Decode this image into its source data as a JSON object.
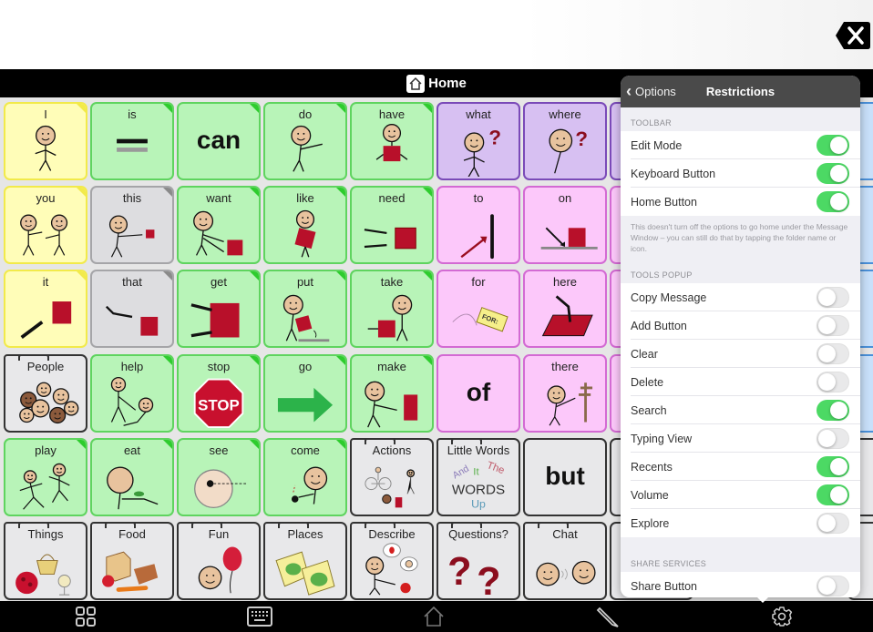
{
  "header": {
    "title": "Home",
    "home_icon": "home-icon",
    "clear_icon": "backspace-x-icon"
  },
  "grid": {
    "tiles": [
      {
        "label": "I",
        "color": "yellow",
        "corner": "#f2ea4a",
        "icon": "person-pointing-self"
      },
      {
        "label": "is",
        "color": "green",
        "corner": "#2ecc2e",
        "icon": "equals-sign"
      },
      {
        "label": "",
        "big": "can",
        "color": "green",
        "corner": "#2ecc2e"
      },
      {
        "label": "do",
        "color": "green",
        "corner": "#2ecc2e",
        "icon": "person-doing"
      },
      {
        "label": "have",
        "color": "green",
        "corner": "#2ecc2e",
        "icon": "person-holding-box"
      },
      {
        "label": "what",
        "color": "purple",
        "icon": "person-question"
      },
      {
        "label": "where",
        "color": "purple",
        "icon": "person-looking-question"
      },
      {
        "label": "you",
        "color": "yellow",
        "corner": "#f2ea4a",
        "icon": "two-people-pointing"
      },
      {
        "label": "this",
        "color": "gray",
        "corner": "#8a8a8a",
        "icon": "person-pointing-box"
      },
      {
        "label": "want",
        "color": "green",
        "corner": "#2ecc2e",
        "icon": "person-reaching-box"
      },
      {
        "label": "like",
        "color": "green",
        "corner": "#2ecc2e",
        "icon": "person-hugging-box"
      },
      {
        "label": "need",
        "color": "green",
        "corner": "#2ecc2e",
        "icon": "hands-reaching-box"
      },
      {
        "label": "to",
        "color": "pink",
        "icon": "arrow-to-line"
      },
      {
        "label": "on",
        "color": "pink",
        "icon": "arrow-on-box"
      },
      {
        "label": "it",
        "color": "yellow",
        "corner": "#f2ea4a",
        "icon": "hand-pointing-box"
      },
      {
        "label": "that",
        "color": "gray",
        "corner": "#8a8a8a",
        "icon": "hand-pointing-far-box"
      },
      {
        "label": "get",
        "color": "green",
        "corner": "#2ecc2e",
        "icon": "hands-grabbing-box"
      },
      {
        "label": "put",
        "color": "green",
        "corner": "#2ecc2e",
        "icon": "person-putting-box"
      },
      {
        "label": "take",
        "color": "green",
        "corner": "#2ecc2e",
        "icon": "person-taking-box"
      },
      {
        "label": "for",
        "color": "pink",
        "icon": "for-tag"
      },
      {
        "label": "here",
        "color": "pink",
        "icon": "hand-pointing-here"
      },
      {
        "label": "People",
        "color": "folder",
        "folder": true,
        "icon": "group-of-faces"
      },
      {
        "label": "help",
        "color": "green",
        "corner": "#2ecc2e",
        "icon": "person-helping"
      },
      {
        "label": "stop",
        "color": "green",
        "corner": "#2ecc2e",
        "icon": "stop-sign",
        "stop_text": "STOP"
      },
      {
        "label": "go",
        "color": "green",
        "corner": "#2ecc2e",
        "icon": "green-arrow-right"
      },
      {
        "label": "make",
        "color": "green",
        "corner": "#2ecc2e",
        "icon": "person-hammering"
      },
      {
        "label": "",
        "big": "of",
        "color": "pink"
      },
      {
        "label": "there",
        "color": "pink",
        "icon": "person-pointing-sign"
      },
      {
        "label": "play",
        "color": "green",
        "corner": "#2ecc2e",
        "icon": "people-running"
      },
      {
        "label": "eat",
        "color": "green",
        "corner": "#2ecc2e",
        "icon": "person-eating"
      },
      {
        "label": "see",
        "color": "green",
        "corner": "#2ecc2e",
        "icon": "face-looking"
      },
      {
        "label": "come",
        "color": "green",
        "corner": "#2ecc2e",
        "icon": "person-beckoning"
      },
      {
        "label": "Actions",
        "color": "folder",
        "folder": true,
        "icon": "actions-collage"
      },
      {
        "label": "Little Words",
        "color": "folder",
        "folder": true,
        "icon": "little-words-collage",
        "words": [
          "And",
          "It",
          "The",
          "WORDS",
          "Up"
        ]
      },
      {
        "label": "",
        "big": "but",
        "color": "folder"
      },
      {
        "label": "Things",
        "color": "folder",
        "folder": true,
        "icon": "things-collage"
      },
      {
        "label": "Food",
        "color": "folder",
        "folder": true,
        "icon": "food-collage"
      },
      {
        "label": "Fun",
        "color": "folder",
        "folder": true,
        "icon": "face-with-balloon"
      },
      {
        "label": "Places",
        "color": "folder",
        "folder": true,
        "icon": "maps"
      },
      {
        "label": "Describe",
        "color": "folder",
        "folder": true,
        "icon": "person-describing"
      },
      {
        "label": "Questions?",
        "color": "folder",
        "folder": true,
        "icon": "question-marks"
      },
      {
        "label": "Chat",
        "color": "folder",
        "folder": true,
        "icon": "faces-chatting"
      }
    ]
  },
  "toolbar": {
    "buttons": [
      {
        "name": "grid-view-button",
        "icon": "grid-icon"
      },
      {
        "name": "keyboard-button",
        "icon": "keyboard-icon"
      },
      {
        "name": "home-button",
        "icon": "home-icon"
      },
      {
        "name": "edit-button",
        "icon": "pencil-icon"
      },
      {
        "name": "settings-button",
        "icon": "gear-icon"
      }
    ]
  },
  "popover": {
    "back_label": "Options",
    "title": "Restrictions",
    "sections": [
      {
        "header": "TOOLBAR",
        "rows": [
          {
            "label": "Edit Mode",
            "on": true
          },
          {
            "label": "Keyboard Button",
            "on": true
          },
          {
            "label": "Home Button",
            "on": true
          }
        ],
        "footnote": "This doesn't turn off the options to go home under the Message Window – you can still do that by tapping the folder name or icon."
      },
      {
        "header": "TOOLS POPUP",
        "rows": [
          {
            "label": "Copy Message",
            "on": false
          },
          {
            "label": "Add Button",
            "on": false
          },
          {
            "label": "Clear",
            "on": false
          },
          {
            "label": "Delete",
            "on": false
          },
          {
            "label": "Search",
            "on": true
          },
          {
            "label": "Typing View",
            "on": false
          },
          {
            "label": "Recents",
            "on": true
          },
          {
            "label": "Volume",
            "on": true
          },
          {
            "label": "Explore",
            "on": false
          }
        ]
      },
      {
        "header": "SHARE SERVICES",
        "rows": [
          {
            "label": "Share Button",
            "on": false
          }
        ]
      }
    ]
  }
}
